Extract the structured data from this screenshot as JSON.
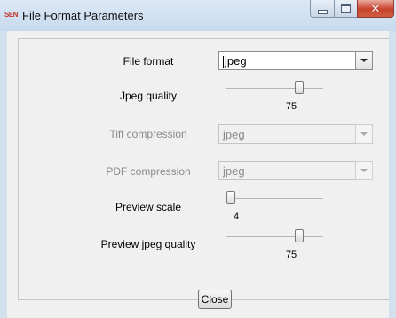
{
  "window": {
    "app_icon_text": "SEN",
    "title": "File Format Parameters"
  },
  "fields": {
    "file_format": {
      "label": "File format",
      "value": "jpeg"
    },
    "jpeg_quality": {
      "label": "Jpeg quality",
      "value": "75",
      "level": 0.75
    },
    "tiff_compression": {
      "label": "Tiff compression",
      "value": "jpeg"
    },
    "pdf_compression": {
      "label": "PDF compression",
      "value": "jpeg"
    },
    "preview_scale": {
      "label": "Preview scale",
      "value": "4",
      "level": 0.05
    },
    "preview_jpeg_quality": {
      "label": "Preview jpeg quality",
      "value": "75",
      "level": 0.75
    }
  },
  "buttons": {
    "close": "Close"
  },
  "icons": {
    "minimize": "minimize-icon",
    "maximize": "maximize-icon",
    "close_window": "close-icon",
    "dropdown": "chevron-down-icon"
  }
}
